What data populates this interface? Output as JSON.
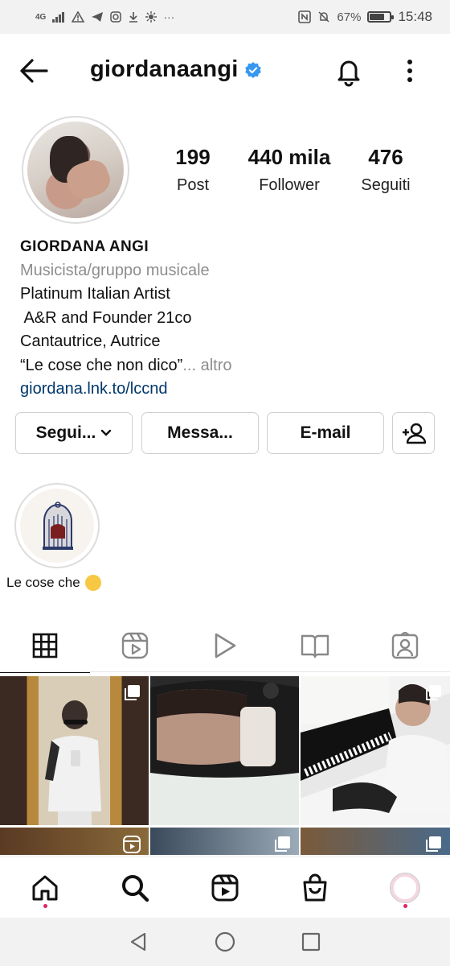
{
  "status_bar": {
    "network": "4G",
    "battery": "67%",
    "battery_level": 0.67,
    "time": "15:48"
  },
  "header": {
    "username": "giordanaangi",
    "verified": true
  },
  "profile": {
    "stats": [
      {
        "value": "199",
        "label": "Post"
      },
      {
        "value": "440 mila",
        "label": "Follower"
      },
      {
        "value": "476",
        "label": "Seguiti"
      }
    ],
    "name": "GIORDANA ANGI",
    "category": "Musicista/gruppo musicale",
    "bio_lines": [
      "Platinum Italian Artist",
      " A&R and Founder 21co",
      "Cantautrice, Autrice"
    ],
    "bio_last_line": "“Le cose che non dico”",
    "more_label": "... altro",
    "link": "giordana.lnk.to/lccnd"
  },
  "actions": {
    "follow_label": "Segui...",
    "message_label": "Messa...",
    "email_label": "E-mail"
  },
  "highlights": [
    {
      "label": "Le cose che"
    }
  ],
  "tabs": [
    "grid",
    "reels",
    "videos",
    "guides",
    "tagged"
  ],
  "grid": {
    "posts": [
      {
        "type": "carousel"
      },
      {
        "type": "photo"
      },
      {
        "type": "carousel"
      },
      {
        "type": "reel"
      },
      {
        "type": "carousel"
      },
      {
        "type": "carousel"
      }
    ]
  },
  "bottom_nav": [
    "home",
    "search",
    "reels",
    "shop",
    "profile"
  ],
  "colors": {
    "verified_blue": "#3897f0",
    "link": "#00376b",
    "muted": "#8e8e8e",
    "notification_dot": "#e0245e"
  }
}
